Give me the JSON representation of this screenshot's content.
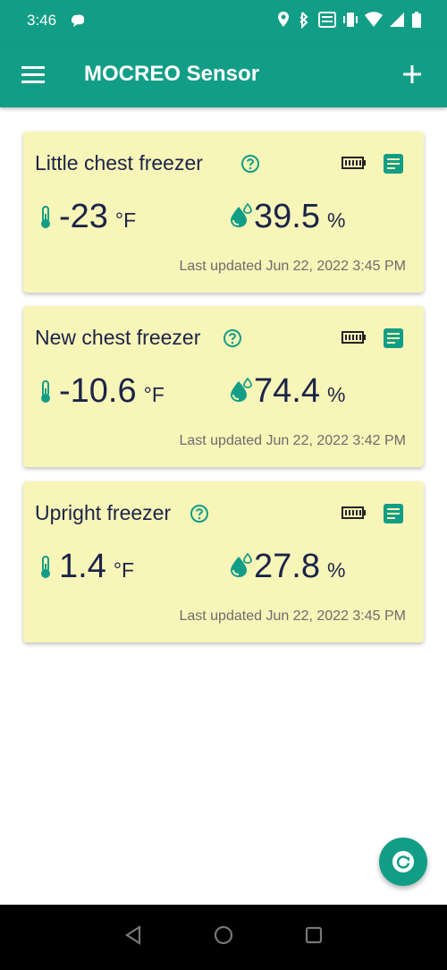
{
  "status_bar": {
    "time": "3:46"
  },
  "app_bar": {
    "title": "MOCREO Sensor"
  },
  "sensors": [
    {
      "name": "Little chest freezer",
      "temperature": "-23",
      "temp_unit": "°F",
      "humidity": "39.5",
      "humidity_unit": "%",
      "last_updated": "Last updated Jun 22, 2022 3:45 PM"
    },
    {
      "name": "New chest freezer",
      "temperature": "-10.6",
      "temp_unit": "°F",
      "humidity": "74.4",
      "humidity_unit": "%",
      "last_updated": "Last updated Jun 22, 2022 3:42 PM"
    },
    {
      "name": "Upright freezer",
      "temperature": "1.4",
      "temp_unit": "°F",
      "humidity": "27.8",
      "humidity_unit": "%",
      "last_updated": "Last updated Jun 22, 2022 3:45 PM"
    }
  ],
  "colors": {
    "accent": "#129e86",
    "card_bg": "#f8f5b8",
    "text_dark": "#1b2449",
    "text_muted": "#6d6d6d"
  },
  "icons": [
    "menu-icon",
    "add-icon",
    "help-icon",
    "battery-icon",
    "log-icon",
    "thermometer-icon",
    "humidity-drop-icon",
    "refresh-icon",
    "back-icon",
    "home-icon",
    "recents-icon"
  ]
}
